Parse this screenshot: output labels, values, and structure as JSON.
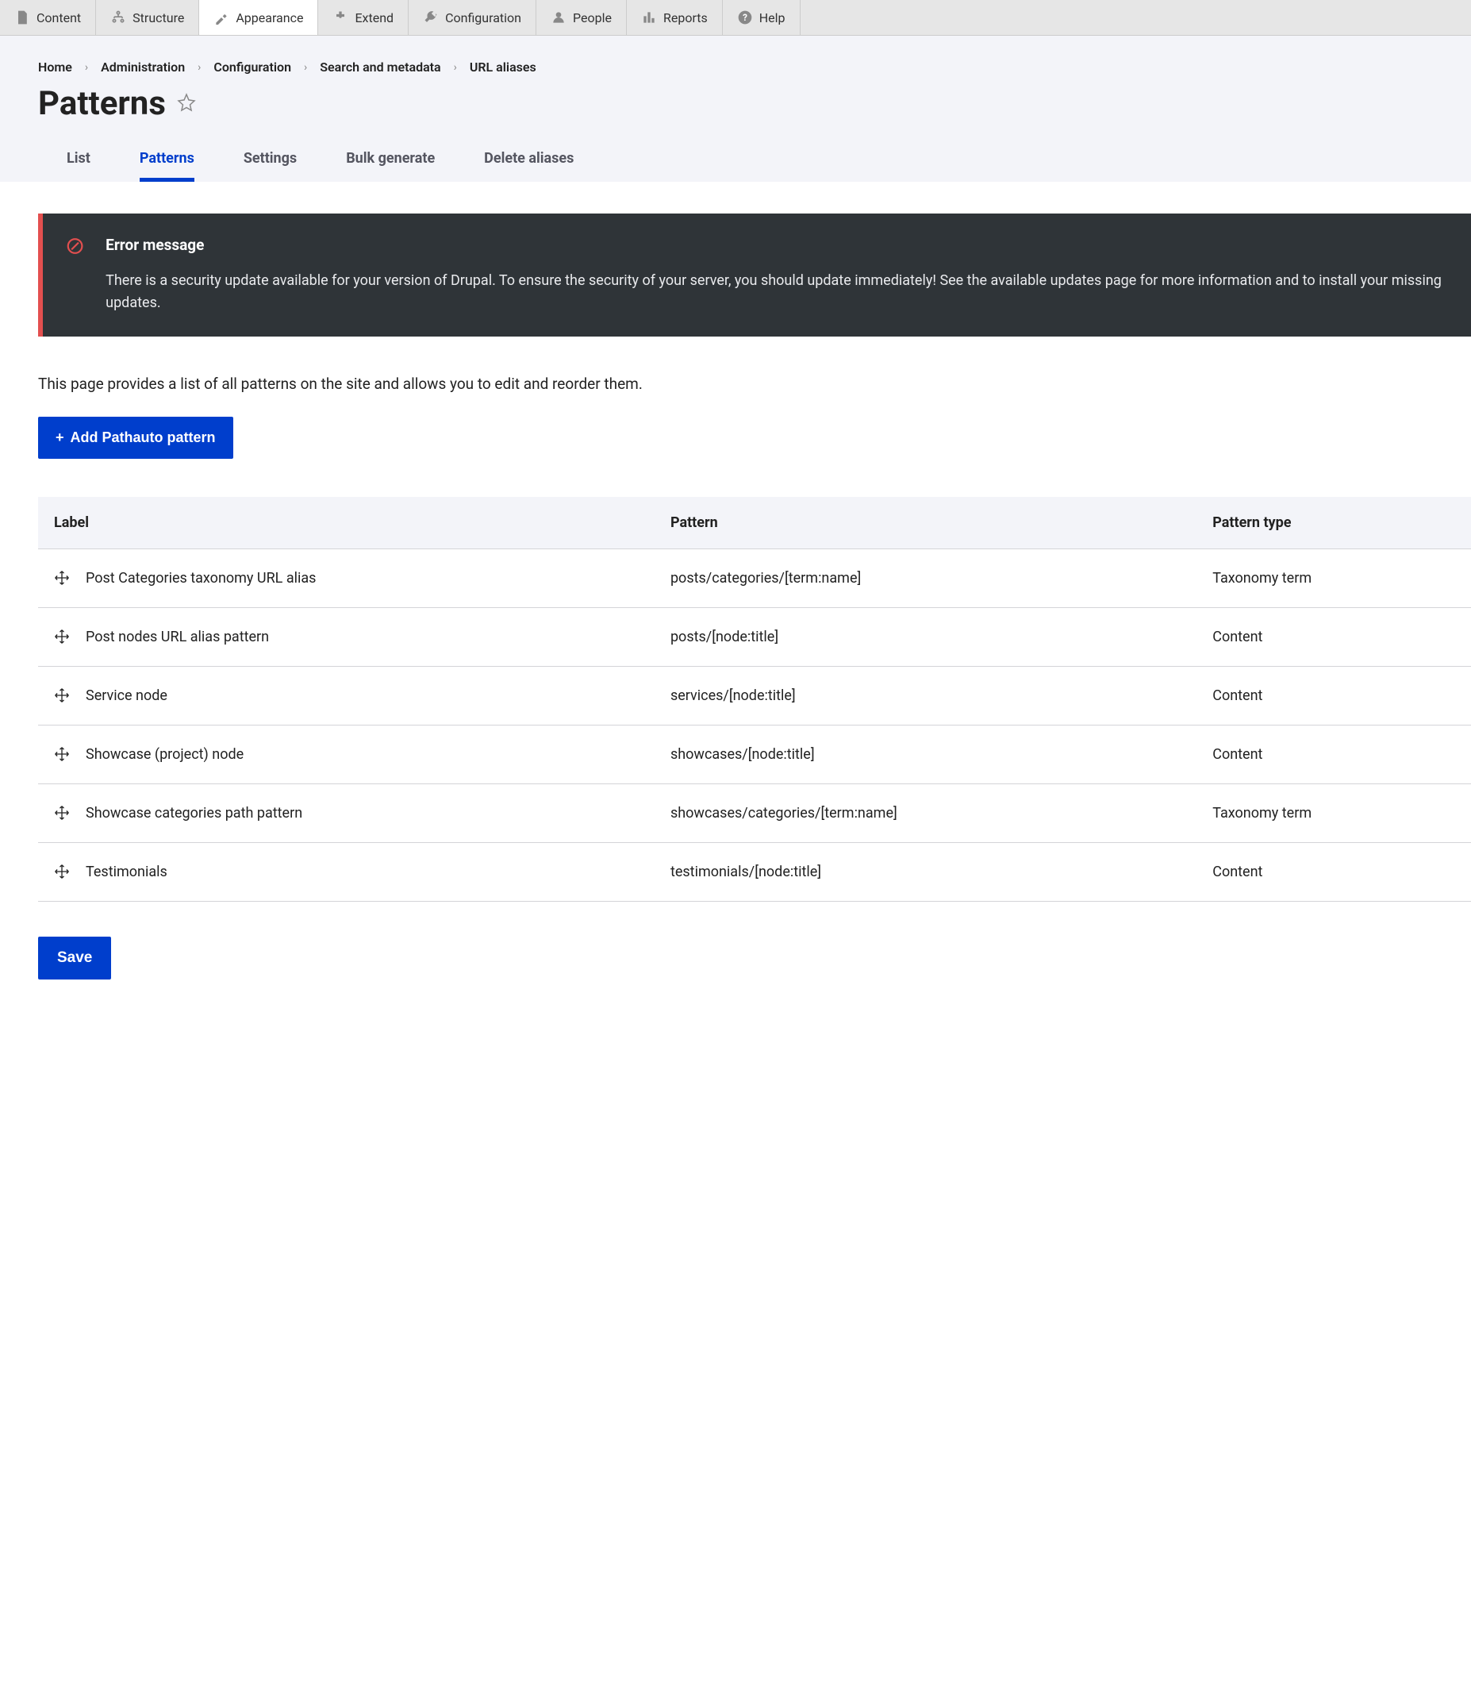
{
  "toolbar": [
    {
      "id": "content",
      "label": "Content"
    },
    {
      "id": "structure",
      "label": "Structure"
    },
    {
      "id": "appearance",
      "label": "Appearance"
    },
    {
      "id": "extend",
      "label": "Extend"
    },
    {
      "id": "configuration",
      "label": "Configuration"
    },
    {
      "id": "people",
      "label": "People"
    },
    {
      "id": "reports",
      "label": "Reports"
    },
    {
      "id": "help",
      "label": "Help"
    }
  ],
  "breadcrumb": [
    "Home",
    "Administration",
    "Configuration",
    "Search and metadata",
    "URL aliases"
  ],
  "page_title": "Patterns",
  "tabs": [
    {
      "id": "list",
      "label": "List"
    },
    {
      "id": "patterns",
      "label": "Patterns",
      "active": true
    },
    {
      "id": "settings",
      "label": "Settings"
    },
    {
      "id": "bulk",
      "label": "Bulk generate"
    },
    {
      "id": "delete",
      "label": "Delete aliases"
    }
  ],
  "error": {
    "title": "Error message",
    "text": "There is a security update available for your version of Drupal. To ensure the security of your server, you should update immediately! See the available updates page for more information and to install your missing updates."
  },
  "description": "This page provides a list of all patterns on the site and allows you to edit and reorder them.",
  "add_button": "Add Pathauto pattern",
  "table": {
    "headers": {
      "label": "Label",
      "pattern": "Pattern",
      "type": "Pattern type"
    },
    "rows": [
      {
        "label": "Post Categories taxonomy URL alias",
        "pattern": "posts/categories/[term:name]",
        "type": "Taxonomy term"
      },
      {
        "label": "Post nodes URL alias pattern",
        "pattern": "posts/[node:title]",
        "type": "Content"
      },
      {
        "label": "Service node",
        "pattern": "services/[node:title]",
        "type": "Content"
      },
      {
        "label": "Showcase (project) node",
        "pattern": "showcases/[node:title]",
        "type": "Content"
      },
      {
        "label": "Showcase categories path pattern",
        "pattern": "showcases/categories/[term:name]",
        "type": "Taxonomy term"
      },
      {
        "label": "Testimonials",
        "pattern": "testimonials/[node:title]",
        "type": "Content"
      }
    ]
  },
  "save_button": "Save"
}
